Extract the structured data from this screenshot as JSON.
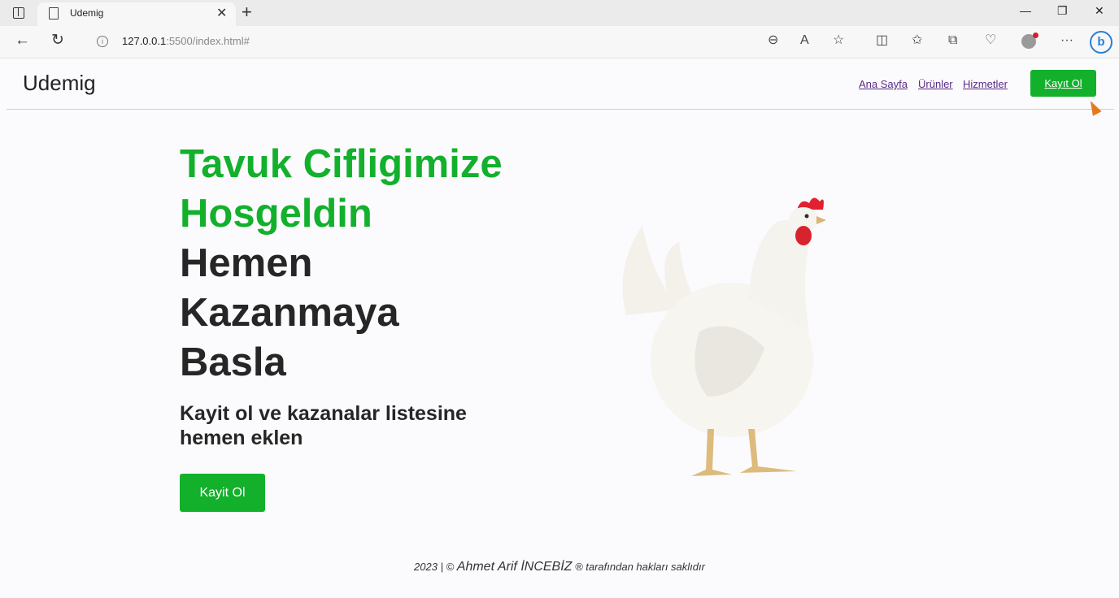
{
  "browser": {
    "tab_title": "Udemig",
    "url_host": "127.0.0.1",
    "url_rest": ":5500/index.html#"
  },
  "header": {
    "brand": "Udemig",
    "nav": [
      "Ana Sayfa",
      "Ürünler",
      "Hizmetler"
    ],
    "cta": "Kayıt Ol"
  },
  "hero": {
    "title_green": [
      "Tavuk Cifligimize",
      "Hosgeldin"
    ],
    "title_dark": [
      "Hemen",
      "Kazanmaya",
      "Basla"
    ],
    "subtitle": "Kayit ol ve kazanalar listesine hemen eklen",
    "button": "Kayit Ol"
  },
  "footer": {
    "prefix": "2023 | ©",
    "author": "Ahmet Arif İNCEBİZ",
    "suffix": "® tarafından hakları saklıdır"
  },
  "colors": {
    "accent": "#13b02c",
    "text": "#262626"
  }
}
